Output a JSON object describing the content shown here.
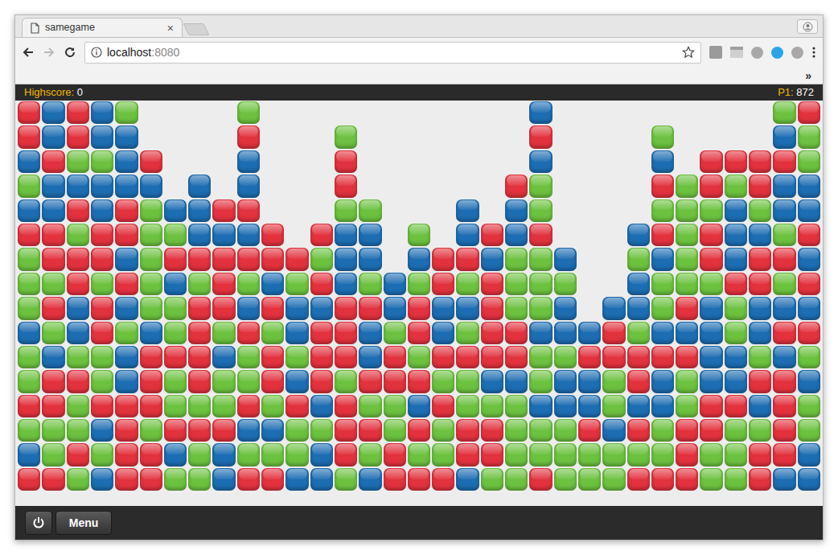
{
  "browser": {
    "tabs": [
      {
        "label": "samegame",
        "selected": true,
        "close": "×"
      }
    ],
    "address": {
      "host": "localhost",
      "port": ":8080"
    },
    "overflow": "»"
  },
  "game": {
    "highscore_label": "Highscore:",
    "highscore": "0",
    "player_label": "P1:",
    "score": "872"
  },
  "board": {
    "colors": {
      "R": "#e2323e",
      "B": "#1d6db2",
      "G": "#6cc13f"
    },
    "rows": [
      "RBRBG....G...........B.........GR",
      "RBRBB....R...G.......R....G....BG",
      "BRGGBR...B...R.......B....B.RRRRG",
      "GBBBBB.B.B...R......RG....RGRGRBB",
      "BBRBRGBBRR...GG...B.BG....GGGBGBB",
      "RRGRRGGBBBR.RBB.G.BRBR...BRGRBBGR",
      "GRRRBGRRRRRRGBB.BRRBGGB..GBGRBRRB",
      "GGRGRGBGRGBGRBGBGRGRGGG..BGGGRRGR",
      "GRBRBGGRRBRBBRRBRBBRGGB.BBGRBGBBB",
      "BGBRGBGRGRGBRRBGRBGRRBBBRGBBBGBRR",
      "GBGGBRRRBGRGRRBRGRRRRGGRRRRRBBGBG",
      "GRRGBRGRGGRBRGRRRGGBBGBBGRBGBBRRB",
      "RRGRRRGGGRGRBRGGBRGGGBBBGBBGRRBRG",
      "GGGBRGRRRBBGGRRGRGRRGGGRBRGRRGGRG",
      "BGRGRRBGBGGGBRGRGGRRGGGGGGGRGGRRB",
      "RRGBRRGGBRRBBGBRRRBGGRGGGRRRGGRBB"
    ]
  },
  "toolbar": {
    "menu_button": "Menu"
  }
}
